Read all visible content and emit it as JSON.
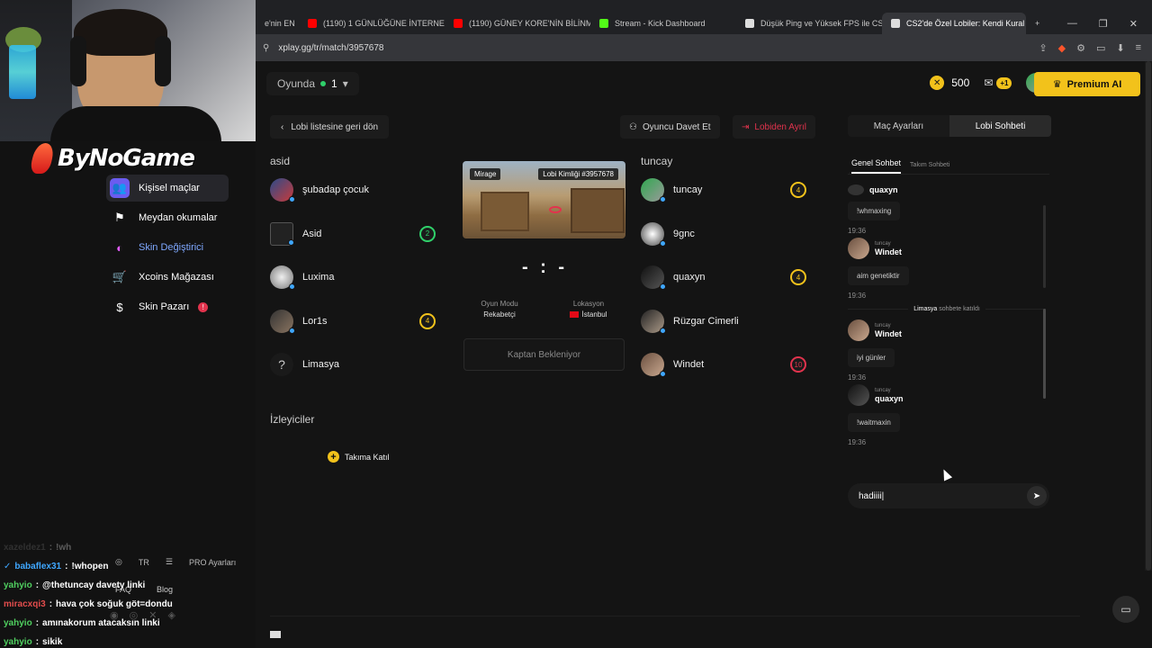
{
  "browser": {
    "tabs": [
      {
        "label": "e'nin EN",
        "fav_color": "#ff0000"
      },
      {
        "label": "(1190) 1 GÜNLÜĞÜNE İNTERNETTE ..",
        "fav_color": "#ff0000"
      },
      {
        "label": "(1190) GÜNEY KORE'NİN BİLİNMEYE",
        "fav_color": "#ff0000"
      },
      {
        "label": "Stream - Kick Dashboard",
        "fav_color": "#53fc18"
      },
      {
        "label": "Düşük Ping ve Yüksek FPS ile CS2 Su",
        "fav_color": "#ffffff"
      },
      {
        "label": "CS2'de Özel Lobiler: Kendi Kural",
        "fav_color": "#ffffff"
      }
    ],
    "new_tab": "+",
    "url": "xplay.gg/tr/match/3957678"
  },
  "stream_overlay": {
    "brand": "ByNoGame"
  },
  "sidebar": {
    "items": [
      {
        "label": "Kişisel maçlar",
        "icon": "users-icon"
      },
      {
        "label": "Meydan okumalar",
        "icon": "flag-icon"
      },
      {
        "label": "Skin Değiştirici",
        "icon": "swap-icon"
      },
      {
        "label": "Xcoins Mağazası",
        "icon": "cart-icon"
      },
      {
        "label": "Skin Pazarı",
        "icon": "dollar-icon",
        "badge": "!"
      }
    ],
    "language": "TR",
    "pro_settings": "PRO Ayarları",
    "faq": "FAQ",
    "blog": "Blog"
  },
  "stream_chat": [
    {
      "user": "xazeldez1",
      "text": "!wh",
      "color": "gray"
    },
    {
      "user": "babaflex31",
      "text": "!whopen",
      "color": "blue",
      "check": true
    },
    {
      "user": "yahyio",
      "text": "@thetuncay davety linki",
      "color": "green"
    },
    {
      "user": "miracxqi3",
      "text": "hava çok soğuk göt=dondu",
      "color": "red"
    },
    {
      "user": "yahyio",
      "text": "amınakorum atacaksın linki",
      "color": "green"
    },
    {
      "user": "yahyio",
      "text": "sikik",
      "color": "green"
    }
  ],
  "header": {
    "status_label": "Oyunda",
    "status_count": "1",
    "coins": "500",
    "mail_badge": "+1",
    "premium_label": "Premium AI"
  },
  "lobby": {
    "back_label": "Lobi listesine geri dön",
    "invite_label": "Oyuncu Davet Et",
    "leave_label": "Lobiden Ayrıl",
    "team_a": {
      "name": "asid",
      "players": [
        {
          "name": "şubadap çocuk",
          "badge": ""
        },
        {
          "name": "Asid",
          "badge": "2",
          "badge_color": "#2fd06a"
        },
        {
          "name": "Luxima",
          "badge": ""
        },
        {
          "name": "Lor1s",
          "badge": "4",
          "badge_color": "#f2c21b"
        },
        {
          "name": "Limasya",
          "badge": ""
        }
      ]
    },
    "team_b": {
      "name": "tuncay",
      "players": [
        {
          "name": "tuncay",
          "badge": "4",
          "badge_color": "#f2c21b"
        },
        {
          "name": "9gnc",
          "badge": ""
        },
        {
          "name": "quaxyn",
          "badge": "4",
          "badge_color": "#f2c21b"
        },
        {
          "name": "Rüzgar Cimerli",
          "badge": ""
        },
        {
          "name": "Windet",
          "badge": "10",
          "badge_color": "#e2334d"
        }
      ]
    },
    "map_name": "Mirage",
    "lobby_id": "Lobi Kimliği #3957678",
    "score": "- : -",
    "mode_label": "Oyun Modu",
    "mode_value": "Rekabetçi",
    "location_label": "Lokasyon",
    "location_value": "İstanbul",
    "captain_label": "Kaptan Bekleniyor",
    "spectators_title": "İzleyiciler",
    "join_team_label": "Takıma Katıl"
  },
  "chat_panel": {
    "tabs": [
      "Maç Ayarları",
      "Lobi Sohbeti"
    ],
    "subtabs": [
      "Genel Sohbet",
      "Takım Sohbeti"
    ],
    "messages": [
      {
        "team": "",
        "user": "quaxyn",
        "text": "!whmaxing",
        "time": "19:36"
      },
      {
        "team": "tuncay",
        "user": "Windet",
        "text": "aim genetiktir",
        "time": "19:36"
      },
      {
        "system_user": "Limasya",
        "system_text": "sohbete katıldı"
      },
      {
        "team": "tuncay",
        "user": "Windet",
        "text": "iyi günler",
        "time": "19:36"
      },
      {
        "team": "tuncay",
        "user": "quaxyn",
        "text": "!waitmaxin",
        "time": "19:36"
      }
    ],
    "input_value": "hadiiii"
  }
}
